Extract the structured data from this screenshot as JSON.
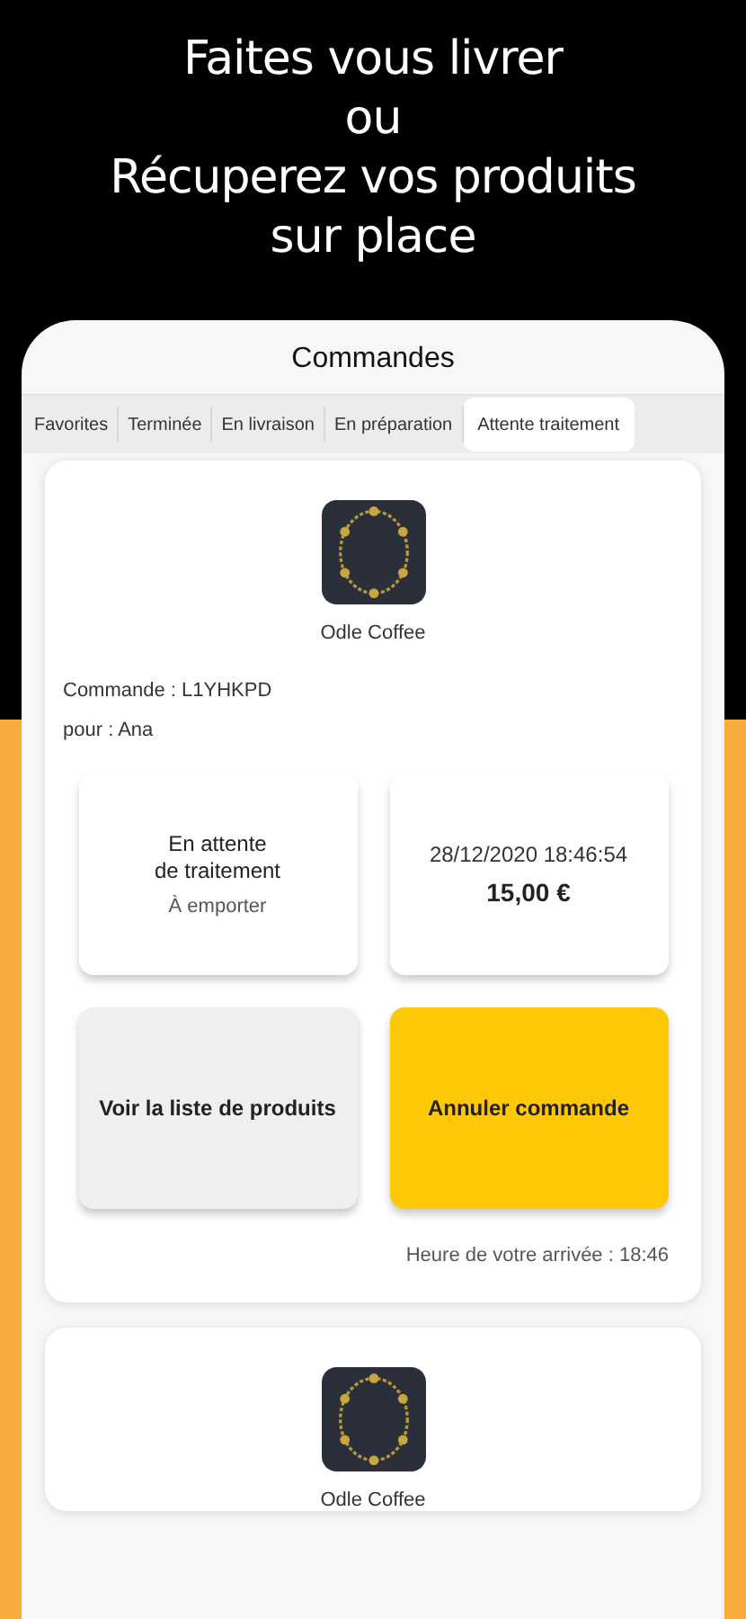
{
  "headline": [
    "Faites vous livrer",
    "ou",
    "Récuperez vos produits",
    "sur place"
  ],
  "screen": {
    "title": "Commandes",
    "tabs": [
      {
        "label": "Favorites",
        "selected": false
      },
      {
        "label": "Terminée",
        "selected": false
      },
      {
        "label": "En livraison",
        "selected": false
      },
      {
        "label": "En préparation",
        "selected": false
      },
      {
        "label": "Attente traitement",
        "selected": true
      }
    ]
  },
  "orders": [
    {
      "shop": "Odle Coffee",
      "order": "Commande : L1YHKPD",
      "customer": "pour : Ana",
      "status": "En attente\nde traitement",
      "mode": "À emporter",
      "date": "28/12/2020 18:46:54",
      "total": "15,00 €",
      "buttons": [
        {
          "label": "Voir la liste de produits",
          "kind": "secondary"
        },
        {
          "label": "Annuler commande",
          "kind": "primary"
        }
      ],
      "arrival": "Heure de votre arrivée : 18:46"
    },
    {
      "shop": "Odle Coffee"
    }
  ]
}
